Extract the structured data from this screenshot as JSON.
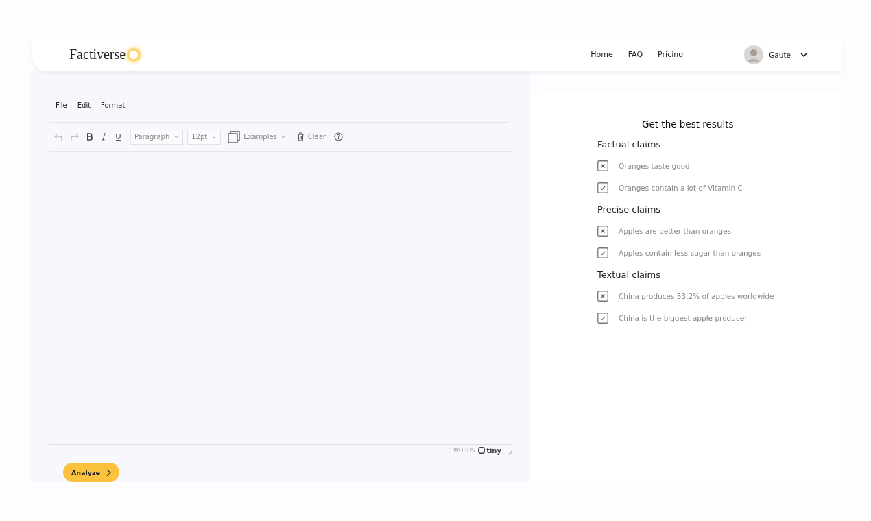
{
  "header": {
    "logo": "Factiverse",
    "nav": [
      {
        "label": "Home"
      },
      {
        "label": "FAQ"
      },
      {
        "label": "Pricing"
      }
    ],
    "user": {
      "name": "Gaute"
    }
  },
  "editor": {
    "menu": [
      "File",
      "Edit",
      "Format"
    ],
    "toolbar": {
      "block_format": "Paragraph",
      "font_size": "12pt",
      "examples": "Examples",
      "clear": "Clear"
    },
    "word_count": "0 WORDS",
    "brand": "tiny",
    "analyze_button": "Analyze"
  },
  "tips": {
    "title": "Get the best results",
    "sections": [
      {
        "heading": "Factual claims",
        "items": [
          {
            "kind": "bad",
            "text": "Oranges taste good"
          },
          {
            "kind": "good",
            "text": "Oranges contain a lot of Vitamin C"
          }
        ]
      },
      {
        "heading": "Precise claims",
        "items": [
          {
            "kind": "bad",
            "text": "Apples are better than oranges"
          },
          {
            "kind": "good",
            "text": "Apples contain less sugar than oranges"
          }
        ]
      },
      {
        "heading": "Textual claims",
        "items": [
          {
            "kind": "bad",
            "text": "China produces 53,2% of apples worldwide"
          },
          {
            "kind": "good",
            "text": "China is the biggest apple producer"
          }
        ]
      }
    ]
  }
}
